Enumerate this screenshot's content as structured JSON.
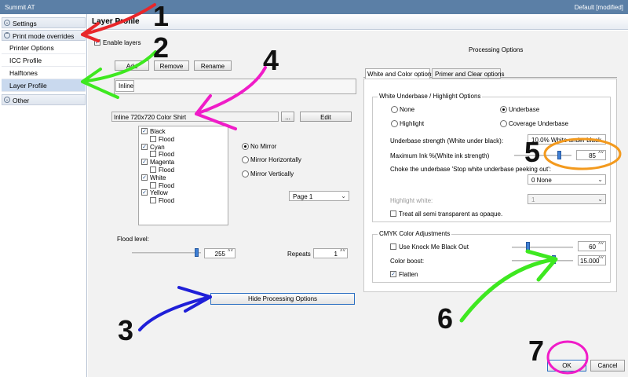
{
  "window": {
    "title": "Summit AT",
    "status": "Default [modified]"
  },
  "sidebar": {
    "settings": "Settings",
    "print_mode": "Print mode overrides",
    "items": [
      "Printer Options",
      "ICC Profile",
      "Halftones",
      "Layer Profile"
    ],
    "other": "Other"
  },
  "header": {
    "title": "Layer Profile"
  },
  "left": {
    "enable_layers": "Enable layers",
    "add": "Add",
    "remove": "Remove",
    "rename": "Rename",
    "tab_inline": "Inline",
    "profile_name": "Inline 720x720 Color Shirt",
    "dots": "...",
    "edit": "Edit",
    "layers": [
      {
        "label": "Black",
        "checked": true
      },
      {
        "label": "Flood",
        "checked": false
      },
      {
        "label": "Cyan",
        "checked": true
      },
      {
        "label": "Flood",
        "checked": false
      },
      {
        "label": "Magenta",
        "checked": true
      },
      {
        "label": "Flood",
        "checked": false
      },
      {
        "label": "White",
        "checked": true
      },
      {
        "label": "Flood",
        "checked": false
      },
      {
        "label": "Yellow",
        "checked": true
      },
      {
        "label": "Flood",
        "checked": false
      }
    ],
    "mirror": [
      "No Mirror",
      "Mirror Horizontally",
      "Mirror Vertically"
    ],
    "page": "Page 1",
    "flood_level_label": "Flood level:",
    "flood_level": "255",
    "repeats_label": "Repeats",
    "repeats": "1",
    "hide_processing": "Hide Processing Options"
  },
  "right": {
    "processing_title": "Processing Options",
    "tab_white": "White and Color options",
    "tab_primer": "Primer and Clear options",
    "wu_group": "White Underbase / Highlight Options",
    "radios": [
      "None",
      "Underbase",
      "Highlight",
      "Coverage Underbase"
    ],
    "underbase_strength_label": "Underbase strength (White under black):",
    "underbase_strength": "10.0% White under black",
    "max_ink_label": "Maximum Ink %(White ink strength)",
    "max_ink": "85",
    "choke_label": "Choke the underbase 'Stop white underbase peeking out':",
    "choke": "0 None",
    "highlight_white_label": "Highlight white:",
    "highlight_white": "1",
    "treat_semi": "Treat all semi transparent as opaque.",
    "cmyk_group": "CMYK Color Adjustments",
    "knock_out": "Use Knock Me Black Out",
    "knock_out_value": "60",
    "color_boost_label": "Color boost:",
    "color_boost": "15.000",
    "flatten": "Flatten"
  },
  "footer": {
    "ok": "OK",
    "cancel": "Cancel"
  },
  "annotations": [
    "1",
    "2",
    "3",
    "4",
    "5",
    "6",
    "7"
  ],
  "colors": {
    "red_arrow": "#e8262a",
    "green_arrow": "#3ee820",
    "blue_arrow": "#1f1fd8",
    "magenta_arrow": "#f01cc8",
    "orange_circle": "#f39a1e",
    "selection": "#c9d9ee",
    "accent": "#3f7fd4"
  }
}
